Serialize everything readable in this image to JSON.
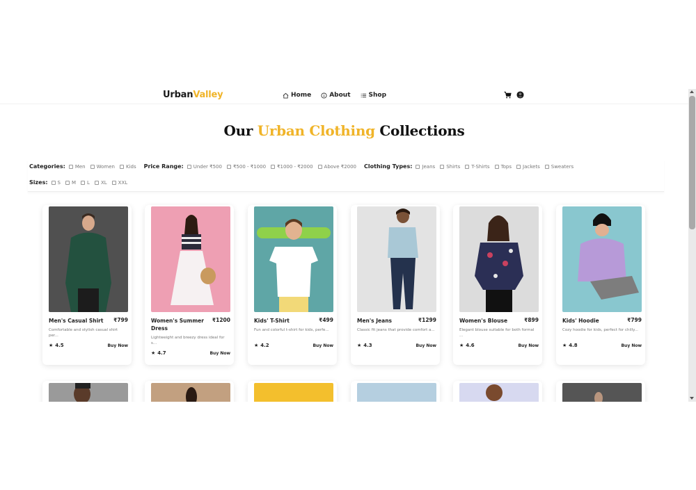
{
  "brand": {
    "part1": "Urban",
    "part2": "Valley"
  },
  "nav": {
    "home": "Home",
    "about": "About",
    "shop": "Shop"
  },
  "heading": {
    "pre": "Our ",
    "highlight": "Urban Clothing",
    "post": " Collections"
  },
  "filters": {
    "categories": {
      "label": "Categories:",
      "options": [
        "Men",
        "Women",
        "Kids"
      ]
    },
    "price": {
      "label": "Price Range:",
      "options": [
        "Under ₹500",
        "₹500 - ₹1000",
        "₹1000 - ₹2000",
        "Above ₹2000"
      ]
    },
    "types": {
      "label": "Clothing Types:",
      "options": [
        "Jeans",
        "Shirts",
        "T-Shirts",
        "Tops",
        "Jackets",
        "Sweaters"
      ]
    },
    "sizes": {
      "label": "Sizes:",
      "options": [
        "S",
        "M",
        "L",
        "XL",
        "XXL"
      ]
    }
  },
  "products": [
    {
      "name": "Men's Casual Shirt",
      "price": "₹799",
      "desc": "Comfortable and stylish casual shirt per...",
      "rating": "4.5",
      "buy": "Buy Now"
    },
    {
      "name": "Women's Summer Dress",
      "price": "₹1200",
      "desc": "Lightweight and breezy dress ideal for s...",
      "rating": "4.7",
      "buy": "Buy Now"
    },
    {
      "name": "Kids' T-Shirt",
      "price": "₹499",
      "desc": "Fun and colorful t-shirt for kids, perfe...",
      "rating": "4.2",
      "buy": "Buy Now"
    },
    {
      "name": "Men's Jeans",
      "price": "₹1299",
      "desc": "Classic fit jeans that provide comfort a...",
      "rating": "4.3",
      "buy": "Buy Now"
    },
    {
      "name": "Women's Blouse",
      "price": "₹899",
      "desc": "Elegant blouse suitable for both formal ...",
      "rating": "4.6",
      "buy": "Buy Now"
    },
    {
      "name": "Kids' Hoodie",
      "price": "₹799",
      "desc": "Cozy hoodie for kids, perfect for chilly...",
      "rating": "4.8",
      "buy": "Buy Now"
    }
  ],
  "icons": {
    "cart": "cart-icon",
    "user": "user-avatar-icon",
    "star": "star-icon"
  },
  "colors": {
    "accent": "#f0b429",
    "text": "#222222"
  }
}
